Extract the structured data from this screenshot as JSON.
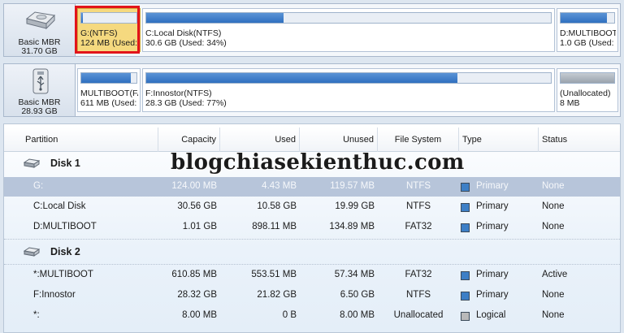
{
  "disk_map": {
    "disk1": {
      "label": "Basic MBR",
      "size": "31.70 GB",
      "partitions": [
        {
          "name": "G:(NTFS)",
          "info": "124 MB (Used:",
          "usage": 0.036
        },
        {
          "name": "C:Local Disk(NTFS)",
          "info": "30.6 GB (Used: 34%)",
          "usage": 0.34
        },
        {
          "name": "D:MULTIBOOT(",
          "info": "1.0 GB (Used:",
          "usage": 0.87
        }
      ]
    },
    "disk2": {
      "label": "Basic MBR",
      "size": "28.93 GB",
      "partitions": [
        {
          "name": "MULTIBOOT(FA",
          "info": "611 MB (Used:",
          "usage": 0.9
        },
        {
          "name": "F:Innostor(NTFS)",
          "info": "28.3 GB (Used: 77%)",
          "usage": 0.77
        },
        {
          "name": "(Unallocated)",
          "info": "8 MB",
          "usage": 1.0
        }
      ]
    }
  },
  "table": {
    "columns": [
      "Partition",
      "Capacity",
      "Used",
      "Unused",
      "File System",
      "Type",
      "Status"
    ],
    "groups": [
      {
        "name": "Disk 1",
        "rows": [
          {
            "partition": "G:",
            "capacity": "124.00 MB",
            "used": "4.43 MB",
            "unused": "119.57 MB",
            "fs": "NTFS",
            "type": "Primary",
            "status": "None"
          },
          {
            "partition": "C:Local Disk",
            "capacity": "30.56 GB",
            "used": "10.58 GB",
            "unused": "19.99 GB",
            "fs": "NTFS",
            "type": "Primary",
            "status": "None"
          },
          {
            "partition": "D:MULTIBOOT",
            "capacity": "1.01 GB",
            "used": "898.11 MB",
            "unused": "134.89 MB",
            "fs": "FAT32",
            "type": "Primary",
            "status": "None"
          }
        ]
      },
      {
        "name": "Disk 2",
        "rows": [
          {
            "partition": "*:MULTIBOOT",
            "capacity": "610.85 MB",
            "used": "553.51 MB",
            "unused": "57.34 MB",
            "fs": "FAT32",
            "type": "Primary",
            "status": "Active"
          },
          {
            "partition": "F:Innostor",
            "capacity": "28.32 GB",
            "used": "21.82 GB",
            "unused": "6.50 GB",
            "fs": "NTFS",
            "type": "Primary",
            "status": "None"
          },
          {
            "partition": "*:",
            "capacity": "8.00 MB",
            "used": "0 B",
            "unused": "8.00 MB",
            "fs": "Unallocated",
            "type": "Logical",
            "status": "None"
          }
        ]
      }
    ]
  },
  "watermark": "blogchiasekienthuc.com",
  "colors": {
    "primary_type": "#3d7fc6",
    "logical_type": "#b9b9b9",
    "usage_bar": "#2f6fbf",
    "selected_partition": "#f5d97f",
    "highlight_box": "#e2141a"
  }
}
